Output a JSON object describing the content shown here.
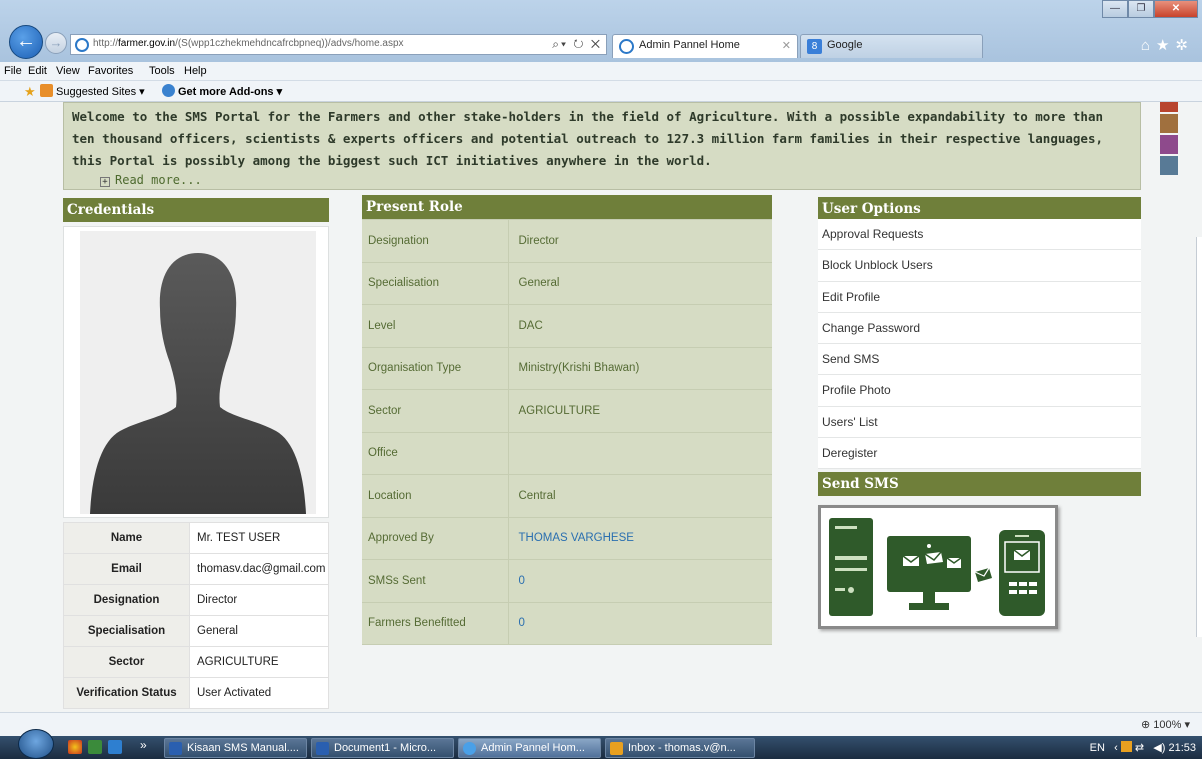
{
  "browser": {
    "address": {
      "prefix": "http://",
      "domain": "farmer.gov.in",
      "path": "/(S(wpp1czhekmehdncafrcbpneq))/advs/home.aspx"
    },
    "tabs": [
      {
        "label": "Admin Pannel Home",
        "active": true
      },
      {
        "label": "Google",
        "active": false
      }
    ],
    "menu": [
      "File",
      "Edit",
      "View",
      "Favorites",
      "Tools",
      "Help"
    ],
    "favorites": [
      {
        "label": "Suggested Sites ▾"
      },
      {
        "label": "Get more Add-ons ▾"
      }
    ],
    "status": {
      "zoom": "100%"
    }
  },
  "banner": {
    "text": "Welcome to the SMS Portal for the Farmers and other stake-holders in the field of Agriculture. With a possible expandability to more than ten thousand officers, scientists & experts officers and potential outreach to 127.3 million farm families in their respective languages, this Portal is possibly among the biggest such ICT initiatives anywhere in the world.",
    "read_more": "Read more..."
  },
  "theme_swatches": [
    "#b8442e",
    "#a0703e",
    "#8e4a8c",
    "#587a96"
  ],
  "credentials": {
    "title": "Credentials",
    "rows": [
      {
        "label": "Name",
        "value": "Mr. TEST USER"
      },
      {
        "label": "Email",
        "value": "thomasv.dac@gmail.com"
      },
      {
        "label": "Designation",
        "value": "Director"
      },
      {
        "label": "Specialisation",
        "value": "General"
      },
      {
        "label": "Sector",
        "value": "AGRICULTURE"
      },
      {
        "label": "Verification Status",
        "value": "User Activated"
      }
    ]
  },
  "present_role": {
    "title": "Present Role",
    "rows": [
      {
        "label": "Designation",
        "value": "Director"
      },
      {
        "label": "Specialisation",
        "value": "General"
      },
      {
        "label": "Level",
        "value": "DAC"
      },
      {
        "label": "Organisation Type",
        "value": "Ministry(Krishi Bhawan)"
      },
      {
        "label": "Sector",
        "value": "AGRICULTURE"
      },
      {
        "label": "Office",
        "value": ""
      },
      {
        "label": "Location",
        "value": "Central"
      },
      {
        "label": "Approved By",
        "value": "THOMAS VARGHESE"
      },
      {
        "label": "SMSs Sent",
        "value": "0"
      },
      {
        "label": "Farmers Benefitted",
        "value": "0"
      }
    ]
  },
  "user_options": {
    "title": "User Options",
    "items": [
      "Approval Requests",
      "Block Unblock Users",
      "Edit Profile",
      "Change Password",
      "Send SMS",
      "Profile Photo",
      "Users' List",
      "Deregister"
    ]
  },
  "send_sms": {
    "title": "Send SMS"
  },
  "taskbar": {
    "items": [
      {
        "label": "Kisaan SMS Manual...."
      },
      {
        "label": "Document1 - Micro..."
      },
      {
        "label": "Admin Pannel Hom..."
      },
      {
        "label": "Inbox - thomas.v@n..."
      }
    ],
    "lang": "EN",
    "time": "21:53"
  },
  "colors": {
    "header_olive": "#6f7f3a",
    "panel_sage": "#d6dcc4",
    "label_green": "#556b34",
    "link_blue": "#2a6fb0"
  }
}
